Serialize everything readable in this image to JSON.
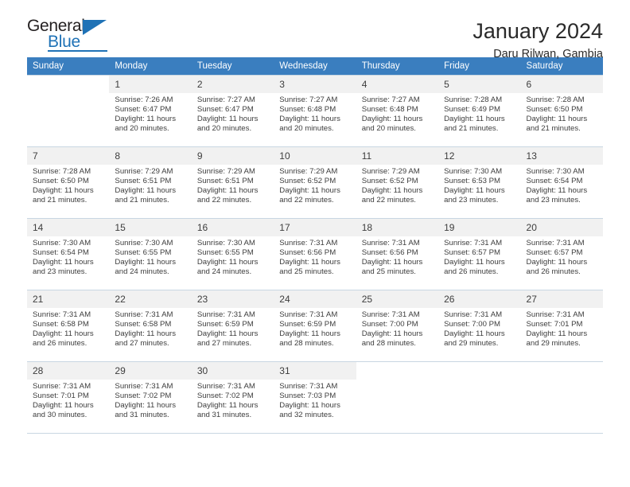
{
  "brand": {
    "name_top": "General",
    "name_bottom": "Blue",
    "triangle_icon": "blue-triangle-icon",
    "accent_color": "#1f72b6"
  },
  "header": {
    "title": "January 2024",
    "subtitle": "Daru Rilwan, Gambia"
  },
  "calendar": {
    "header_bg": "#3a7ebf",
    "daynum_bg": "#f1f1f1",
    "grid_line_color": "#c8d6e2",
    "weekday_headers": [
      "Sunday",
      "Monday",
      "Tuesday",
      "Wednesday",
      "Thursday",
      "Friday",
      "Saturday"
    ],
    "weeks": [
      [
        {
          "day": "",
          "lines": []
        },
        {
          "day": "1",
          "lines": [
            "Sunrise: 7:26 AM",
            "Sunset: 6:47 PM",
            "Daylight: 11 hours",
            "and 20 minutes."
          ]
        },
        {
          "day": "2",
          "lines": [
            "Sunrise: 7:27 AM",
            "Sunset: 6:47 PM",
            "Daylight: 11 hours",
            "and 20 minutes."
          ]
        },
        {
          "day": "3",
          "lines": [
            "Sunrise: 7:27 AM",
            "Sunset: 6:48 PM",
            "Daylight: 11 hours",
            "and 20 minutes."
          ]
        },
        {
          "day": "4",
          "lines": [
            "Sunrise: 7:27 AM",
            "Sunset: 6:48 PM",
            "Daylight: 11 hours",
            "and 20 minutes."
          ]
        },
        {
          "day": "5",
          "lines": [
            "Sunrise: 7:28 AM",
            "Sunset: 6:49 PM",
            "Daylight: 11 hours",
            "and 21 minutes."
          ]
        },
        {
          "day": "6",
          "lines": [
            "Sunrise: 7:28 AM",
            "Sunset: 6:50 PM",
            "Daylight: 11 hours",
            "and 21 minutes."
          ]
        }
      ],
      [
        {
          "day": "7",
          "lines": [
            "Sunrise: 7:28 AM",
            "Sunset: 6:50 PM",
            "Daylight: 11 hours",
            "and 21 minutes."
          ]
        },
        {
          "day": "8",
          "lines": [
            "Sunrise: 7:29 AM",
            "Sunset: 6:51 PM",
            "Daylight: 11 hours",
            "and 21 minutes."
          ]
        },
        {
          "day": "9",
          "lines": [
            "Sunrise: 7:29 AM",
            "Sunset: 6:51 PM",
            "Daylight: 11 hours",
            "and 22 minutes."
          ]
        },
        {
          "day": "10",
          "lines": [
            "Sunrise: 7:29 AM",
            "Sunset: 6:52 PM",
            "Daylight: 11 hours",
            "and 22 minutes."
          ]
        },
        {
          "day": "11",
          "lines": [
            "Sunrise: 7:29 AM",
            "Sunset: 6:52 PM",
            "Daylight: 11 hours",
            "and 22 minutes."
          ]
        },
        {
          "day": "12",
          "lines": [
            "Sunrise: 7:30 AM",
            "Sunset: 6:53 PM",
            "Daylight: 11 hours",
            "and 23 minutes."
          ]
        },
        {
          "day": "13",
          "lines": [
            "Sunrise: 7:30 AM",
            "Sunset: 6:54 PM",
            "Daylight: 11 hours",
            "and 23 minutes."
          ]
        }
      ],
      [
        {
          "day": "14",
          "lines": [
            "Sunrise: 7:30 AM",
            "Sunset: 6:54 PM",
            "Daylight: 11 hours",
            "and 23 minutes."
          ]
        },
        {
          "day": "15",
          "lines": [
            "Sunrise: 7:30 AM",
            "Sunset: 6:55 PM",
            "Daylight: 11 hours",
            "and 24 minutes."
          ]
        },
        {
          "day": "16",
          "lines": [
            "Sunrise: 7:30 AM",
            "Sunset: 6:55 PM",
            "Daylight: 11 hours",
            "and 24 minutes."
          ]
        },
        {
          "day": "17",
          "lines": [
            "Sunrise: 7:31 AM",
            "Sunset: 6:56 PM",
            "Daylight: 11 hours",
            "and 25 minutes."
          ]
        },
        {
          "day": "18",
          "lines": [
            "Sunrise: 7:31 AM",
            "Sunset: 6:56 PM",
            "Daylight: 11 hours",
            "and 25 minutes."
          ]
        },
        {
          "day": "19",
          "lines": [
            "Sunrise: 7:31 AM",
            "Sunset: 6:57 PM",
            "Daylight: 11 hours",
            "and 26 minutes."
          ]
        },
        {
          "day": "20",
          "lines": [
            "Sunrise: 7:31 AM",
            "Sunset: 6:57 PM",
            "Daylight: 11 hours",
            "and 26 minutes."
          ]
        }
      ],
      [
        {
          "day": "21",
          "lines": [
            "Sunrise: 7:31 AM",
            "Sunset: 6:58 PM",
            "Daylight: 11 hours",
            "and 26 minutes."
          ]
        },
        {
          "day": "22",
          "lines": [
            "Sunrise: 7:31 AM",
            "Sunset: 6:58 PM",
            "Daylight: 11 hours",
            "and 27 minutes."
          ]
        },
        {
          "day": "23",
          "lines": [
            "Sunrise: 7:31 AM",
            "Sunset: 6:59 PM",
            "Daylight: 11 hours",
            "and 27 minutes."
          ]
        },
        {
          "day": "24",
          "lines": [
            "Sunrise: 7:31 AM",
            "Sunset: 6:59 PM",
            "Daylight: 11 hours",
            "and 28 minutes."
          ]
        },
        {
          "day": "25",
          "lines": [
            "Sunrise: 7:31 AM",
            "Sunset: 7:00 PM",
            "Daylight: 11 hours",
            "and 28 minutes."
          ]
        },
        {
          "day": "26",
          "lines": [
            "Sunrise: 7:31 AM",
            "Sunset: 7:00 PM",
            "Daylight: 11 hours",
            "and 29 minutes."
          ]
        },
        {
          "day": "27",
          "lines": [
            "Sunrise: 7:31 AM",
            "Sunset: 7:01 PM",
            "Daylight: 11 hours",
            "and 29 minutes."
          ]
        }
      ],
      [
        {
          "day": "28",
          "lines": [
            "Sunrise: 7:31 AM",
            "Sunset: 7:01 PM",
            "Daylight: 11 hours",
            "and 30 minutes."
          ]
        },
        {
          "day": "29",
          "lines": [
            "Sunrise: 7:31 AM",
            "Sunset: 7:02 PM",
            "Daylight: 11 hours",
            "and 31 minutes."
          ]
        },
        {
          "day": "30",
          "lines": [
            "Sunrise: 7:31 AM",
            "Sunset: 7:02 PM",
            "Daylight: 11 hours",
            "and 31 minutes."
          ]
        },
        {
          "day": "31",
          "lines": [
            "Sunrise: 7:31 AM",
            "Sunset: 7:03 PM",
            "Daylight: 11 hours",
            "and 32 minutes."
          ]
        },
        {
          "day": "",
          "lines": []
        },
        {
          "day": "",
          "lines": []
        },
        {
          "day": "",
          "lines": []
        }
      ]
    ]
  }
}
